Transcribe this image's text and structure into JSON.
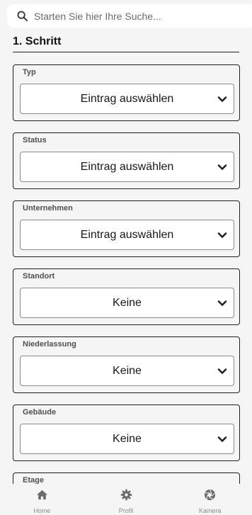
{
  "search": {
    "placeholder": "Starten Sie hier Ihre Suche..."
  },
  "step": {
    "title": "1. Schritt"
  },
  "fields": [
    {
      "label": "Typ",
      "value": "Eintrag auswählen"
    },
    {
      "label": "Status",
      "value": "Eintrag auswählen"
    },
    {
      "label": "Unternehmen",
      "value": "Eintrag auswählen"
    },
    {
      "label": "Standort",
      "value": "Keine"
    },
    {
      "label": "Niederlassung",
      "value": "Keine"
    },
    {
      "label": "Gebäude",
      "value": "Keine"
    },
    {
      "label": "Etage",
      "value": ""
    }
  ],
  "nav": {
    "home": {
      "label": "Home",
      "icon": "home-icon"
    },
    "profile": {
      "label": "Profil",
      "icon": "gear-icon"
    },
    "camera": {
      "label": "Kamera",
      "icon": "aperture-icon"
    }
  },
  "colors": {
    "background": "#f5f5f5",
    "border": "#1f1f1f",
    "icon": "#6b6b6b"
  }
}
